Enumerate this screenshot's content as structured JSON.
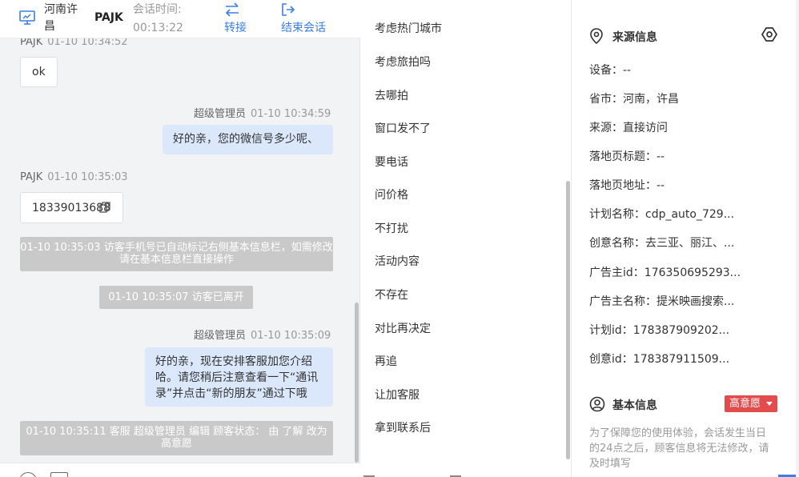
{
  "header": {
    "location": "河南许昌",
    "visitor_name": "PAJK",
    "session_time_label": "会话时间:",
    "session_time_value": "00:13:22",
    "transfer_label": "转接",
    "end_session_label": "结束会话"
  },
  "messages": [
    {
      "sender": "PAJK",
      "time": "01-10 10:34:52",
      "text": "ok"
    },
    {
      "sender": "超级管理员",
      "time": "01-10 10:34:59",
      "text": "好的亲，您的微信号多少呢、"
    },
    {
      "sender": "PAJK",
      "time": "01-10 10:35:03",
      "text": "18339013688"
    },
    {
      "system": "01-10 10:35:03 访客手机号已自动标记右侧基本信息栏，如需修改请在基本信息栏直接操作"
    },
    {
      "system": "01-10 10:35:07 访客已离开"
    },
    {
      "sender": "超级管理员",
      "time": "01-10 10:35:09",
      "lines": [
        "好的亲，现在安排客服加您介绍",
        "哈。请您稍后注意查看一下“通讯",
        "录”并点击“新的朋友”通过下哦"
      ]
    },
    {
      "system": "01-10 10:35:11 客服 超级管理员 编辑 顾客状态： 由 了解 改为 高意愿"
    }
  ],
  "quick_replies": [
    "考虑热门城市",
    "考虑旅拍吗",
    "去哪拍",
    "窗口发不了",
    "要电话",
    "问价格",
    "不打扰",
    "活动内容",
    "不存在",
    "对比再决定",
    "再追",
    "让加客服",
    "拿到联系后"
  ],
  "source_info": {
    "title": "来源信息",
    "rows": [
      {
        "label": "设备：",
        "value": "--"
      },
      {
        "label": "省市：",
        "value": "河南，许昌"
      },
      {
        "label": "来源：",
        "value": "直接访问"
      },
      {
        "label": "落地页标题：",
        "value": "--"
      },
      {
        "label": "落地页地址：",
        "value": "--"
      },
      {
        "label": "计划名称：",
        "value": "cdp_auto_729..."
      },
      {
        "label": "创意名称：",
        "value": "去三亚、丽江、..."
      },
      {
        "label": "广告主id：",
        "value": "176350695293..."
      },
      {
        "label": "广告主名称：",
        "value": "提米映画搜索..."
      },
      {
        "label": "计划id：",
        "value": "178387909202..."
      },
      {
        "label": "创意id：",
        "value": "178387911509..."
      }
    ]
  },
  "basic_info": {
    "title": "基本信息",
    "intent_badge": "高意愿",
    "note": "为了保障您的使用体验，会话发生当日的24点之后，顾客信息将无法修改，请及时填写"
  },
  "colors": {
    "accent": "#3a7ee6",
    "badge": "#e24c4c",
    "bubble_out": "#dbe8fb",
    "system_note": "#c9c9c9"
  }
}
